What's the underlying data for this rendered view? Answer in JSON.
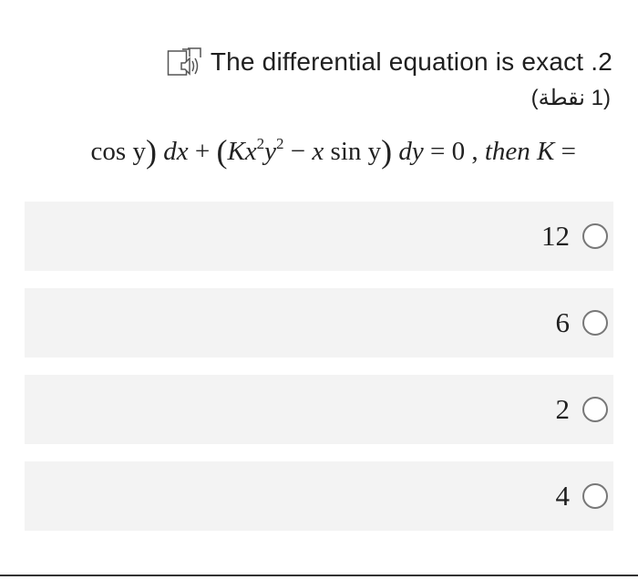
{
  "question": {
    "title": "The differential equation is exact .2",
    "points": "(1 نقطة)",
    "speaker_icon": "speaker-icon"
  },
  "equation": {
    "p1": "cos y",
    "dx": "dx",
    "plus": " + ",
    "K": "K",
    "x": "x",
    "sq": "2",
    "y": "y",
    "minus": " − ",
    "xsin": "x",
    "siny": " sin y",
    "dy": "dy",
    "eq0": " = 0 , ",
    "then": "then K",
    "eq": " ="
  },
  "options": [
    {
      "label": "12"
    },
    {
      "label": "6"
    },
    {
      "label": "2"
    },
    {
      "label": "4"
    }
  ],
  "colors": {
    "option_bg": "#f3f3f3",
    "radio_border": "#777777",
    "text": "#1f1f1f"
  }
}
